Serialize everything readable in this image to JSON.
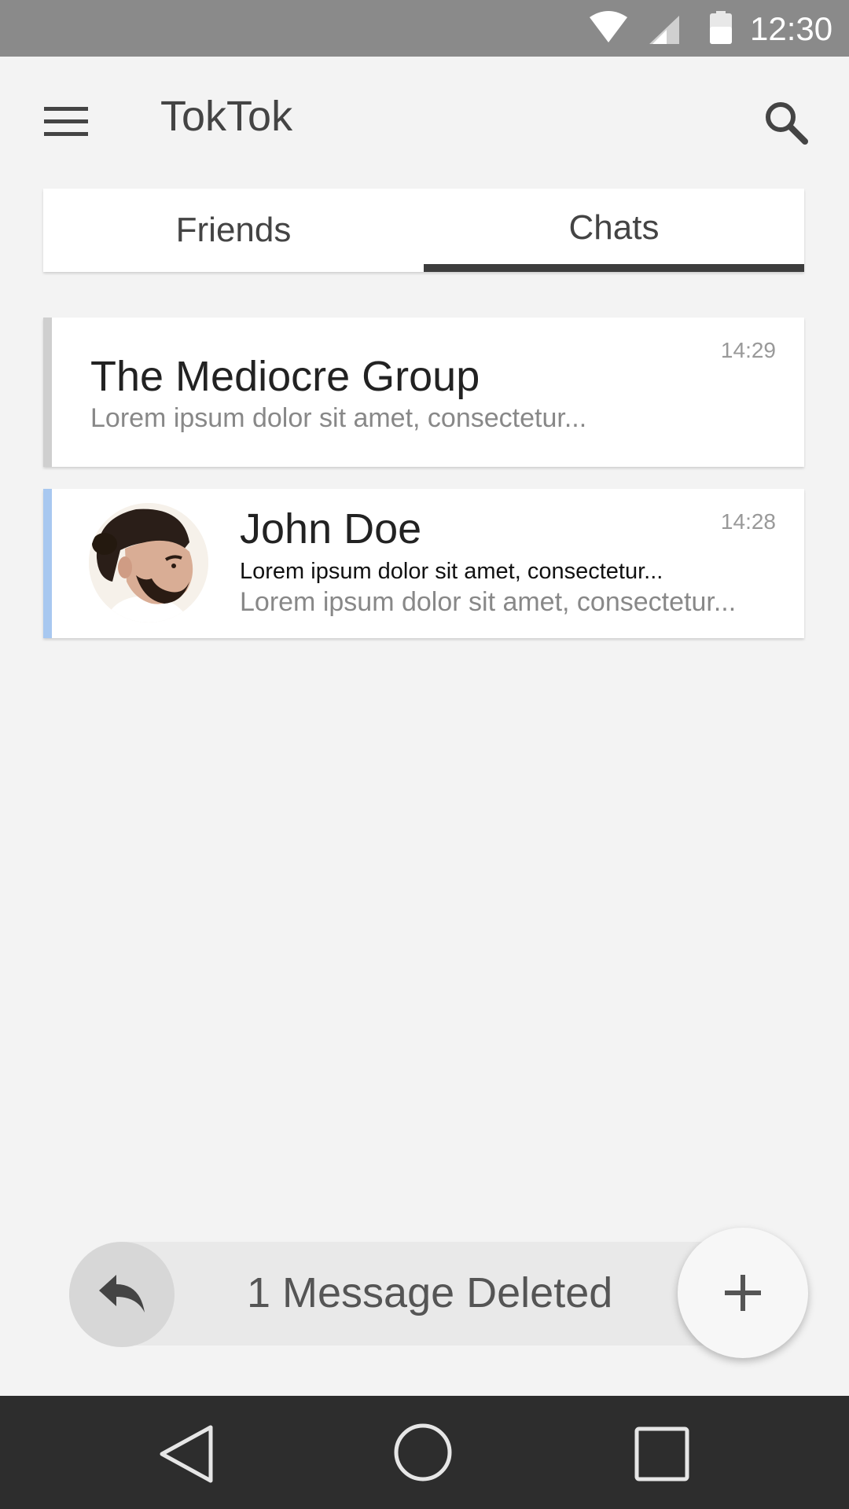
{
  "status_bar": {
    "time": "12:30",
    "icons": [
      "wifi-icon",
      "signal-icon",
      "battery-icon"
    ]
  },
  "app_bar": {
    "title": "TokTok",
    "menu_icon": "menu-icon",
    "search_icon": "search-icon"
  },
  "tabs": [
    {
      "label": "Friends",
      "active": false
    },
    {
      "label": "Chats",
      "active": true
    }
  ],
  "chats": [
    {
      "name": "The Mediocre Group",
      "time": "14:29",
      "preview": "Lorem ipsum dolor sit amet, consectetur...",
      "accent_color": "#cfcfcf",
      "has_avatar": false
    },
    {
      "name": "John Doe",
      "time": "14:28",
      "preview_unread": "Lorem ipsum dolor sit amet, consectetur...",
      "preview": "Lorem ipsum dolor sit amet, consectetur...",
      "accent_color": "#a8c8f0",
      "has_avatar": true
    }
  ],
  "snackbar": {
    "message": "1 Message Deleted",
    "action_icon": "undo-icon"
  },
  "fab": {
    "icon": "plus-icon"
  },
  "nav_bar": {
    "icons": [
      "back-icon",
      "home-icon",
      "recent-apps-icon"
    ]
  }
}
